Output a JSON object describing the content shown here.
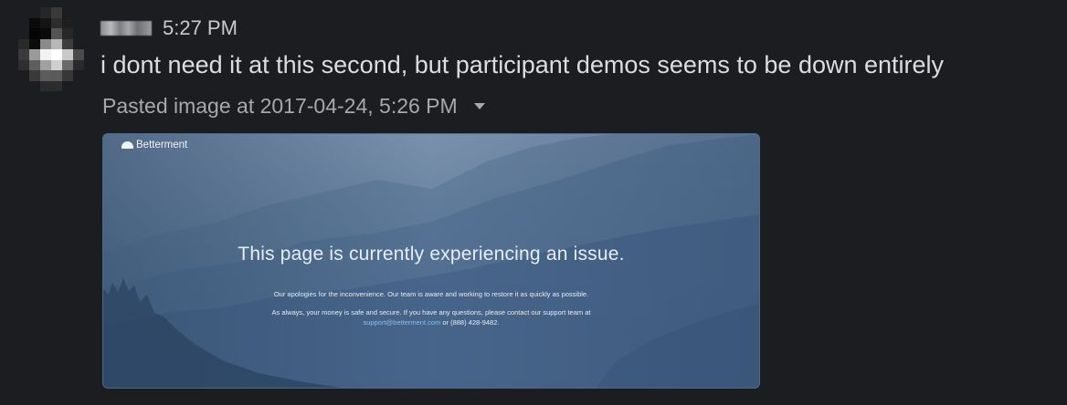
{
  "message": {
    "timestamp": "5:27 PM",
    "text": "i dont need it at this second, but participant demos seems to be down entirely"
  },
  "attachment": {
    "label": "Pasted image at 2017-04-24, 5:26 PM",
    "caret_icon": "chevron-down-icon"
  },
  "screenshot": {
    "brand": "Betterment",
    "title": "This page is currently experiencing an issue.",
    "line1": "Our apologies for the inconvenience. Our team is aware and working to restore it as quickly as possible.",
    "line2": "As always, your money is safe and secure. If you have any questions, please contact our support team at",
    "email": "support@betterment.com",
    "phone": " or (888) 428-9482."
  },
  "colors": {
    "background": "#1b1d21",
    "text": "#dcddde",
    "muted": "#a7a8aa",
    "image_border": "#4e6a89",
    "link": "#8cc0ee"
  }
}
